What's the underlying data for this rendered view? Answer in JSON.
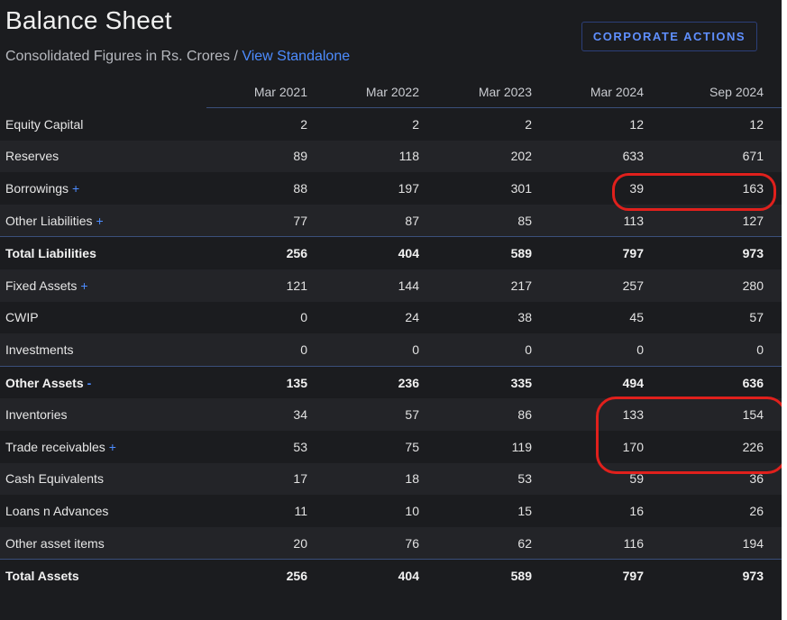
{
  "header": {
    "title": "Balance Sheet",
    "subtitle_prefix": "Consolidated Figures in Rs. Crores / ",
    "view_link": "View Standalone",
    "action_button": "CORPORATE ACTIONS"
  },
  "table": {
    "columns": [
      "Mar 2021",
      "Mar 2022",
      "Mar 2023",
      "Mar 2024",
      "Sep 2024"
    ],
    "rows": [
      {
        "label": "Equity Capital",
        "suffix": "",
        "values": [
          "2",
          "2",
          "2",
          "12",
          "12"
        ]
      },
      {
        "label": "Reserves",
        "suffix": "",
        "values": [
          "89",
          "118",
          "202",
          "633",
          "671"
        ]
      },
      {
        "label": "Borrowings",
        "suffix": "+",
        "values": [
          "88",
          "197",
          "301",
          "39",
          "163"
        ]
      },
      {
        "label": "Other Liabilities",
        "suffix": "+",
        "values": [
          "77",
          "87",
          "85",
          "113",
          "127"
        ]
      },
      {
        "label": "Total Liabilities",
        "suffix": "",
        "values": [
          "256",
          "404",
          "589",
          "797",
          "973"
        ]
      },
      {
        "label": "Fixed Assets",
        "suffix": "+",
        "values": [
          "121",
          "144",
          "217",
          "257",
          "280"
        ]
      },
      {
        "label": "CWIP",
        "suffix": "",
        "values": [
          "0",
          "24",
          "38",
          "45",
          "57"
        ]
      },
      {
        "label": "Investments",
        "suffix": "",
        "values": [
          "0",
          "0",
          "0",
          "0",
          "0"
        ]
      },
      {
        "label": "Other Assets",
        "suffix": "-",
        "values": [
          "135",
          "236",
          "335",
          "494",
          "636"
        ]
      },
      {
        "label": "Inventories",
        "suffix": "",
        "values": [
          "34",
          "57",
          "86",
          "133",
          "154"
        ]
      },
      {
        "label": "Trade receivables",
        "suffix": "+",
        "values": [
          "53",
          "75",
          "119",
          "170",
          "226"
        ]
      },
      {
        "label": "Cash Equivalents",
        "suffix": "",
        "values": [
          "17",
          "18",
          "53",
          "59",
          "36"
        ]
      },
      {
        "label": "Loans n Advances",
        "suffix": "",
        "values": [
          "11",
          "10",
          "15",
          "16",
          "26"
        ]
      },
      {
        "label": "Other asset items",
        "suffix": "",
        "values": [
          "20",
          "76",
          "62",
          "116",
          "194"
        ]
      },
      {
        "label": "Total Assets",
        "suffix": "",
        "values": [
          "256",
          "404",
          "589",
          "797",
          "973"
        ]
      }
    ]
  },
  "colors": {
    "background": "#1b1c1f",
    "link": "#4d8cff",
    "annotation": "#e0201c"
  }
}
